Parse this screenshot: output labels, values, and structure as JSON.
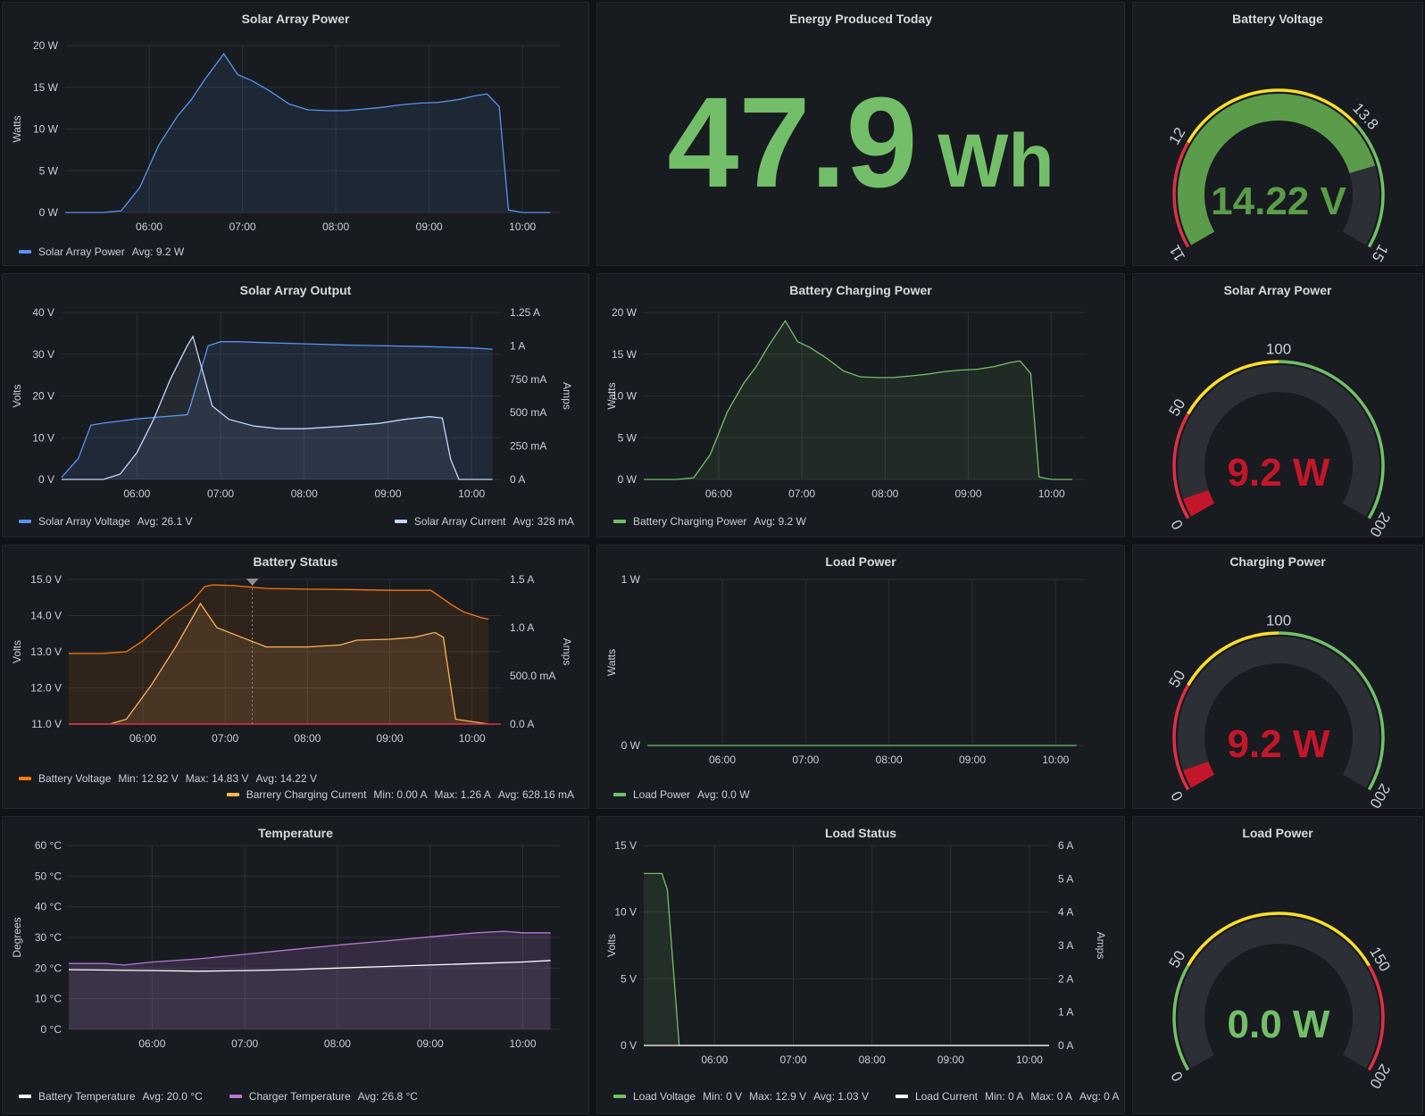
{
  "colors": {
    "blue": "#5794f2",
    "lightblue": "#c0d8ff",
    "green": "#73bf69",
    "orange": "#ff780a",
    "peach": "#ffb357",
    "purple": "#b877d9",
    "white": "#ffffff",
    "red": "#e02f44",
    "yellow": "#fade2a",
    "grid": "#2c3035"
  },
  "time_ticks": [
    "06:00",
    "07:00",
    "08:00",
    "09:00",
    "10:00"
  ],
  "panels": {
    "solar_power": {
      "title": "Solar Array Power",
      "y_label": "Watts",
      "y_ticks": [
        "0 W",
        "5 W",
        "10 W",
        "15 W",
        "20 W"
      ],
      "legend": [
        {
          "name": "Solar Array Power",
          "stats": [
            "Avg: 9.2 W"
          ],
          "color": "#5794f2"
        }
      ]
    },
    "energy_today": {
      "title": "Energy Produced Today",
      "value": "47.9",
      "unit": "Wh"
    },
    "battery_voltage_gauge": {
      "title": "Battery Voltage",
      "value_text": "14.22 V",
      "ticks": [
        "11",
        "12",
        "13.8",
        "15"
      ]
    },
    "solar_output": {
      "title": "Solar Array Output",
      "y_label": "Volts",
      "y2_label": "Amps",
      "y_ticks": [
        "0 V",
        "10 V",
        "20 V",
        "30 V",
        "40 V"
      ],
      "y2_ticks": [
        "0 A",
        "250 mA",
        "500 mA",
        "750 mA",
        "1 A",
        "1.25 A"
      ],
      "legend_left": {
        "name": "Solar Array Voltage",
        "stats": [
          "Avg: 26.1 V"
        ],
        "color": "#5794f2"
      },
      "legend_right": {
        "name": "Solar Array Current",
        "stats": [
          "Avg: 328 mA"
        ],
        "color": "#c0d8ff"
      }
    },
    "battery_charging": {
      "title": "Battery Charging Power",
      "y_label": "Watts",
      "y_ticks": [
        "0 W",
        "5 W",
        "10 W",
        "15 W",
        "20 W"
      ],
      "legend": [
        {
          "name": "Battery Charging Power",
          "stats": [
            "Avg: 9.2 W"
          ],
          "color": "#73bf69"
        }
      ]
    },
    "solar_power_gauge": {
      "title": "Solar Array Power",
      "value_text": "9.2 W",
      "ticks": [
        "0",
        "50",
        "100",
        "200"
      ]
    },
    "battery_status": {
      "title": "Battery Status",
      "y_label": "Volts",
      "y2_label": "Amps",
      "y_ticks": [
        "11.0 V",
        "12.0 V",
        "13.0 V",
        "14.0 V",
        "15.0 V"
      ],
      "y2_ticks": [
        "0.0 A",
        "500.0 mA",
        "1.0 A",
        "1.5 A"
      ],
      "legend_line1": {
        "name": "Battery Voltage",
        "stats": [
          "Min: 12.92 V",
          "Max: 14.83 V",
          "Avg: 14.22 V"
        ],
        "color": "#ff780a"
      },
      "legend_line2": {
        "name": "Barrery Charging Current",
        "stats": [
          "Min: 0.00 A",
          "Max: 1.26 A",
          "Avg: 628.16 mA"
        ],
        "color": "#ffb357"
      }
    },
    "load_power": {
      "title": "Load Power",
      "y_label": "Watts",
      "y_ticks": [
        "0 W",
        "1 W"
      ],
      "legend": [
        {
          "name": "Load Power",
          "stats": [
            "Avg: 0.0 W"
          ],
          "color": "#73bf69"
        }
      ]
    },
    "charging_power_gauge": {
      "title": "Charging Power",
      "value_text": "9.2 W",
      "ticks": [
        "0",
        "50",
        "100",
        "200"
      ]
    },
    "temperature": {
      "title": "Temperature",
      "y_label": "Degrees",
      "y_ticks": [
        "0 °C",
        "10 °C",
        "20 °C",
        "30 °C",
        "40 °C",
        "50 °C",
        "60 °C"
      ],
      "legend": [
        {
          "name": "Battery Temperature",
          "stats": [
            "Avg: 20.0 °C"
          ],
          "color": "#ffffff"
        },
        {
          "name": "Charger Temperature",
          "stats": [
            "Avg: 26.8 °C"
          ],
          "color": "#b877d9"
        }
      ]
    },
    "load_status": {
      "title": "Load Status",
      "y_label": "Volts",
      "y2_label": "Amps",
      "y_ticks": [
        "0 V",
        "5 V",
        "10 V",
        "15 V"
      ],
      "y2_ticks": [
        "0 A",
        "1 A",
        "2 A",
        "3 A",
        "4 A",
        "5 A",
        "6 A"
      ],
      "legend": [
        {
          "name": "Load Voltage",
          "stats": [
            "Min: 0 V",
            "Max: 12.9 V",
            "Avg: 1.03 V"
          ],
          "color": "#73bf69"
        },
        {
          "name": "Load Current",
          "stats": [
            "Min: 0 A",
            "Max: 0 A",
            "Avg: 0 A"
          ],
          "color": "#ffffff"
        }
      ]
    },
    "load_power_gauge": {
      "title": "Load Power",
      "value_text": "0.0 W",
      "ticks": [
        "0",
        "50",
        "150",
        "200"
      ]
    }
  },
  "chart_data": [
    {
      "type": "area",
      "title": "Solar Array Power",
      "ylabel": "Watts",
      "ylim": [
        0,
        20
      ],
      "x_range": [
        "05:05",
        "10:25"
      ],
      "series": [
        {
          "name": "Solar Array Power",
          "x": [
            5.1,
            5.5,
            5.7,
            5.9,
            6.1,
            6.3,
            6.45,
            6.6,
            6.8,
            6.95,
            7.1,
            7.3,
            7.5,
            7.7,
            7.9,
            8.1,
            8.3,
            8.5,
            8.7,
            8.9,
            9.1,
            9.3,
            9.5,
            9.62,
            9.75,
            9.85,
            10.0,
            10.3
          ],
          "y": [
            0,
            0,
            0.2,
            3,
            8,
            11.5,
            13.5,
            16,
            19,
            16.5,
            15.8,
            14.5,
            13,
            12.3,
            12.2,
            12.2,
            12.4,
            12.6,
            12.9,
            13.1,
            13.2,
            13.5,
            14,
            14.2,
            12.7,
            0.3,
            0,
            0
          ]
        }
      ]
    },
    {
      "type": "line",
      "title": "Solar Array Output",
      "ylabel": "Volts",
      "y2label": "Amps",
      "ylim": [
        0,
        40
      ],
      "y2lim": [
        0,
        1.25
      ],
      "series": [
        {
          "name": "Solar Array Voltage",
          "x": [
            5.1,
            5.3,
            5.45,
            5.6,
            5.8,
            6.0,
            6.3,
            6.6,
            6.63,
            6.85,
            7.0,
            7.2,
            7.5,
            8.0,
            8.5,
            9.0,
            9.5,
            10.0,
            10.25
          ],
          "y": [
            0.5,
            5,
            13,
            13.5,
            14,
            14.5,
            15,
            15.5,
            17,
            32,
            33,
            33,
            32.8,
            32.5,
            32.2,
            32,
            31.8,
            31.5,
            31.2
          ]
        },
        {
          "name": "Solar Array Current",
          "x": [
            5.1,
            5.6,
            5.8,
            6.0,
            6.2,
            6.4,
            6.6,
            6.67,
            6.9,
            7.1,
            7.4,
            7.7,
            8.0,
            8.5,
            8.9,
            9.2,
            9.5,
            9.65,
            9.75,
            9.85,
            10.25
          ],
          "y": [
            0,
            0,
            0.04,
            0.2,
            0.45,
            0.75,
            1.0,
            1.07,
            0.55,
            0.45,
            0.4,
            0.38,
            0.38,
            0.4,
            0.42,
            0.45,
            0.47,
            0.46,
            0.15,
            0,
            0
          ]
        }
      ]
    },
    {
      "type": "area",
      "title": "Battery Charging Power",
      "ylabel": "Watts",
      "ylim": [
        0,
        20
      ],
      "series": [
        {
          "name": "Battery Charging Power",
          "x": [
            5.1,
            5.5,
            5.7,
            5.9,
            6.1,
            6.3,
            6.45,
            6.6,
            6.8,
            6.95,
            7.1,
            7.3,
            7.5,
            7.7,
            7.9,
            8.1,
            8.3,
            8.5,
            8.7,
            8.9,
            9.1,
            9.3,
            9.5,
            9.62,
            9.75,
            9.85,
            10.0,
            10.25
          ],
          "y": [
            0,
            0,
            0.2,
            3,
            8,
            11.5,
            13.5,
            16,
            19,
            16.5,
            15.8,
            14.5,
            13,
            12.3,
            12.2,
            12.2,
            12.4,
            12.6,
            12.9,
            13.1,
            13.2,
            13.5,
            14,
            14.2,
            12.7,
            0.3,
            0,
            0
          ]
        }
      ]
    },
    {
      "type": "area",
      "title": "Battery Status",
      "ylabel": "Volts",
      "y2label": "Amps",
      "ylim": [
        11,
        15
      ],
      "y2lim": [
        0,
        1.5
      ],
      "series": [
        {
          "name": "Battery Voltage",
          "x": [
            5.1,
            5.5,
            5.8,
            6.0,
            6.3,
            6.6,
            6.75,
            6.85,
            7.1,
            7.5,
            8.0,
            8.5,
            9.0,
            9.5,
            9.75,
            9.9,
            10.1,
            10.2
          ],
          "y": [
            12.95,
            12.95,
            13.0,
            13.3,
            13.9,
            14.4,
            14.8,
            14.85,
            14.83,
            14.75,
            14.73,
            14.72,
            14.7,
            14.7,
            14.3,
            14.1,
            13.95,
            13.9
          ]
        },
        {
          "name": "Barrery Charging Current",
          "x": [
            5.1,
            5.4,
            5.6,
            5.8,
            6.1,
            6.4,
            6.7,
            6.9,
            7.2,
            7.5,
            8.0,
            8.4,
            8.6,
            9.0,
            9.3,
            9.55,
            9.65,
            9.8,
            10.2
          ],
          "y": [
            0,
            0,
            0,
            0.05,
            0.4,
            0.8,
            1.25,
            1.0,
            0.9,
            0.8,
            0.8,
            0.82,
            0.87,
            0.88,
            0.9,
            0.95,
            0.9,
            0.05,
            0
          ]
        }
      ]
    },
    {
      "type": "line",
      "title": "Load Power",
      "ylabel": "Watts",
      "ylim": [
        0,
        1
      ],
      "series": [
        {
          "name": "Load Power",
          "x": [
            5.1,
            10.25
          ],
          "y": [
            0,
            0
          ]
        }
      ]
    },
    {
      "type": "area",
      "title": "Temperature",
      "ylabel": "Degrees",
      "ylim": [
        0,
        60
      ],
      "series": [
        {
          "name": "Battery Temperature",
          "x": [
            5.1,
            6.0,
            6.5,
            7.0,
            7.5,
            8.0,
            8.5,
            9.0,
            9.5,
            10.0,
            10.3
          ],
          "y": [
            19.5,
            19.2,
            19,
            19.2,
            19.5,
            20,
            20.5,
            21,
            21.5,
            22,
            22.5
          ]
        },
        {
          "name": "Charger Temperature",
          "x": [
            5.1,
            5.5,
            5.7,
            6.0,
            6.5,
            7.0,
            7.5,
            8.0,
            8.5,
            9.0,
            9.5,
            9.8,
            10.0,
            10.3
          ],
          "y": [
            21.5,
            21.5,
            21,
            22,
            23,
            24.5,
            26,
            27.5,
            28.8,
            30.2,
            31.5,
            32,
            31.5,
            31.5
          ]
        }
      ]
    },
    {
      "type": "area",
      "title": "Load Status",
      "ylabel": "Volts",
      "y2label": "Amps",
      "ylim": [
        0,
        15
      ],
      "y2lim": [
        0,
        6
      ],
      "series": [
        {
          "name": "Load Voltage",
          "x": [
            5.1,
            5.33,
            5.4,
            5.55,
            10.25
          ],
          "y": [
            12.9,
            12.9,
            11.7,
            0,
            0
          ]
        },
        {
          "name": "Load Current",
          "x": [
            5.1,
            10.25
          ],
          "y": [
            0,
            0
          ]
        }
      ]
    }
  ],
  "gauges": {
    "battery_voltage": {
      "min": 11,
      "max": 15,
      "value": 14.22,
      "thresholds": [
        {
          "from": 11,
          "to": 12,
          "color": "#e02f44"
        },
        {
          "from": 12,
          "to": 13.8,
          "color": "#fade2a"
        },
        {
          "from": 13.8,
          "to": 15,
          "color": "#73bf69"
        }
      ],
      "value_color": "#5b9c4a"
    },
    "solar_power": {
      "min": 0,
      "max": 200,
      "value": 9.2,
      "thresholds": [
        {
          "from": 0,
          "to": 50,
          "color": "#e02f44"
        },
        {
          "from": 50,
          "to": 100,
          "color": "#fade2a"
        },
        {
          "from": 100,
          "to": 200,
          "color": "#73bf69"
        }
      ],
      "value_color": "#c4162a"
    },
    "charging_power": {
      "min": 0,
      "max": 200,
      "value": 9.2,
      "thresholds": [
        {
          "from": 0,
          "to": 50,
          "color": "#e02f44"
        },
        {
          "from": 50,
          "to": 100,
          "color": "#fade2a"
        },
        {
          "from": 100,
          "to": 200,
          "color": "#73bf69"
        }
      ],
      "value_color": "#c4162a"
    },
    "load_power": {
      "min": 0,
      "max": 200,
      "value": 0,
      "thresholds": [
        {
          "from": 0,
          "to": 50,
          "color": "#73bf69"
        },
        {
          "from": 50,
          "to": 150,
          "color": "#fade2a"
        },
        {
          "from": 150,
          "to": 200,
          "color": "#e02f44"
        }
      ],
      "value_color": "#73bf69"
    }
  }
}
